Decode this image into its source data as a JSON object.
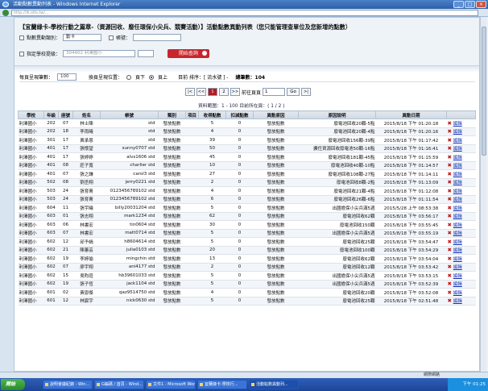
{
  "window": {
    "title": "活動點數異動列表 - Windows Internet Explorer",
    "address": "http://ik.stls.tw/..."
  },
  "header": {
    "title": "【宜蘭綠卡-學校行動之篇章-（資源回收、廢任環保小尖兵、競賽活動）】活動點數異動列表（您只能管理查單位及您新增的點數）",
    "f1_label": "點數異動類別：",
    "f1_value": "動卡",
    "f2_label": "帳號：",
    "f3_label": "指定學校提級：",
    "f3_value": "304402 利澤國小",
    "query_btn": "開始查詢"
  },
  "toolbar": {
    "per_page_label": "每頁呈現筆數：",
    "per_page": "100",
    "layout_label": "換頁呈現位置：",
    "opt_bottom": "頁下",
    "opt_top": "頁上",
    "sort_label": "目前 排序：[ 流水號 ] -",
    "total_label": "總筆數：104"
  },
  "pager": {
    "first": "|<",
    "prev": "<<",
    "p1": "1",
    "p2": "2",
    "next": ">>",
    "last": ">|",
    "goto_label": "前往頁頁",
    "goto_value": "1",
    "go": "Go",
    "range": "資料範圍：1 - 100  目前所在頁：( 1 / 2 )"
  },
  "table": {
    "headers": [
      "學校",
      "年級",
      "座號",
      "姓名",
      "帳號",
      "類別",
      "項目",
      "收得點數",
      "扣減點數",
      "異動原因",
      "原因說明",
      "異動日期",
      ""
    ],
    "rows": [
      [
        "利澤國小",
        "202",
        "07",
        "林士陳",
        "std",
        "發放點數",
        "",
        "5",
        "0",
        "發放點數",
        "廢電池回收20顆-5點",
        "2015/8/18 下午 01:20:18"
      ],
      [
        "利澤國小",
        "202",
        "18",
        "李雨曦",
        "std",
        "發放點數",
        "",
        "4",
        "0",
        "發放點數",
        "廢電池回收20顆-4點",
        "2015/8/18 下午 01:20:16"
      ],
      [
        "利澤國小",
        "301",
        "17",
        "黃承恩",
        "std",
        "發放點數",
        "",
        "39",
        "0",
        "發放點數",
        "廢電池回收156顆-39點",
        "2015/8/18 下午 01:17:42"
      ],
      [
        "利澤國小",
        "401",
        "17",
        "張懷望",
        "sunny0707 std",
        "發放點數",
        "",
        "50",
        "0",
        "發放點數",
        "擴任資源回收廢電池50顆-16點",
        "2015/8/18 下午 01:16:41"
      ],
      [
        "利澤國小",
        "401",
        "17",
        "張婷婷",
        "alvs1606 std",
        "發放點數",
        "",
        "45",
        "0",
        "發放點數",
        "廢電池回收181顆-45點",
        "2015/8/18 下午 01:15:59"
      ],
      [
        "利澤國小",
        "401",
        "08",
        "莊子寬",
        "charlier std",
        "發放點數",
        "",
        "10",
        "0",
        "發放點數",
        "廢電池回收40顆-10點",
        "2015/8/18 下午 01:14:57"
      ],
      [
        "利澤國小",
        "401",
        "07",
        "張之謙",
        "carol3 std",
        "發放點數",
        "",
        "27",
        "0",
        "發放點數",
        "廢電池回收108顆-27點",
        "2015/8/18 下午 01:14:11"
      ],
      [
        "利澤國小",
        "502",
        "08",
        "劉丞翔",
        "jerry0221 std",
        "發放點數",
        "",
        "2",
        "0",
        "發放點數",
        "廢電池回收8顆-2點",
        "2015/8/18 下午 01:13:09"
      ],
      [
        "利澤國小",
        "503",
        "24",
        "張育菁",
        "0123456789102 std",
        "發放點數",
        "",
        "4",
        "0",
        "發放點數",
        "廢電池回收21顆-4點",
        "2015/8/18 下午 01:12:08"
      ],
      [
        "利澤國小",
        "503",
        "24",
        "張育菁",
        "0123456789102 std",
        "發放點數",
        "",
        "6",
        "0",
        "發放點數",
        "廢電池回收26顆-6點",
        "2015/8/18 下午 01:11:54"
      ],
      [
        "利澤國小",
        "604",
        "11",
        "張宇曦",
        "billy20031204 std",
        "發放點數",
        "",
        "5",
        "0",
        "發放點數",
        "出國擔保小尖兵滿5週",
        "2015/5/28 上午 08:53:38"
      ],
      [
        "利澤國小",
        "603",
        "01",
        "張志翔",
        "mark1234 std",
        "發放點數",
        "",
        "62",
        "0",
        "發放點數",
        "廢電池回收62顆",
        "2015/8/18 下午 03:56:17"
      ],
      [
        "利澤國小",
        "603",
        "06",
        "林書宏",
        "tin0604 std",
        "發放點數",
        "",
        "30",
        "0",
        "發放點數",
        "廢電池回收150顆",
        "2015/8/18 下午 03:55:45"
      ],
      [
        "利澤國小",
        "603",
        "07",
        "林書宏",
        "matt0714 std",
        "發放點數",
        "",
        "5",
        "0",
        "發放點數",
        "出國擔保小尖兵滿5週",
        "2015/8/18 下午 03:55:19"
      ],
      [
        "利澤國小",
        "602",
        "12",
        "邱予嫣",
        "h8604614 std",
        "發放點數",
        "",
        "5",
        "0",
        "發放點數",
        "廢電池回收25顆",
        "2015/8/18 下午 03:54:47"
      ],
      [
        "利澤國小",
        "602",
        "21",
        "陳蕙芸",
        "julia0103 std",
        "發放點數",
        "",
        "20",
        "0",
        "發放點數",
        "廢電池回收100顆",
        "2015/8/18 下午 03:54:29"
      ],
      [
        "利澤國小",
        "602",
        "19",
        "李婷瑜",
        "mingchin std",
        "發放點數",
        "",
        "13",
        "0",
        "發放點數",
        "廢電池回收62顆",
        "2015/8/18 下午 03:54:04"
      ],
      [
        "利澤國小",
        "602",
        "07",
        "廖宇翔",
        "ani4177 std",
        "發放點數",
        "",
        "2",
        "0",
        "發放點數",
        "廢電池回收12顆",
        "2015/8/18 下午 03:53:42"
      ],
      [
        "利澤國小",
        "602",
        "15",
        "吳昀瑄",
        "hb39601033 std",
        "發放點數",
        "",
        "5",
        "0",
        "發放點數",
        "出國擔保小尖兵滿5週",
        "2015/8/18 下午 03:53:15"
      ],
      [
        "利澤國小",
        "602",
        "19",
        "張子恆",
        "jack1104 std",
        "發放點數",
        "",
        "5",
        "0",
        "發放點數",
        "出國擔保小尖兵滿5週",
        "2015/8/18 下午 03:52:39"
      ],
      [
        "利澤國小",
        "601",
        "02",
        "黃恩傑",
        "qaz9514750 std",
        "發放點數",
        "",
        "4",
        "0",
        "發放點數",
        "廢電池回收20顆",
        "2015/8/18 下午 03:52:08"
      ],
      [
        "利澤國小",
        "601",
        "12",
        "林宸宇",
        "nick0630 std",
        "發放點數",
        "",
        "5",
        "0",
        "發放點數",
        "廢電池回收25顆",
        "2015/8/18 下午 02:51:48"
      ]
    ],
    "delete_symbol": "✖",
    "edit_label": "編輯"
  },
  "statusbar": {
    "zoom": "網際網路"
  },
  "taskbar": {
    "start": "開始",
    "tasks": [
      "說明會議紀錄 - Win...",
      "G編碼 / 首頁 - Wind...",
      "文件1 - Microsoft Word",
      "宜蘭綠卡-學校行...",
      "活動點數異動列..."
    ],
    "clock": "下午 01:25"
  }
}
